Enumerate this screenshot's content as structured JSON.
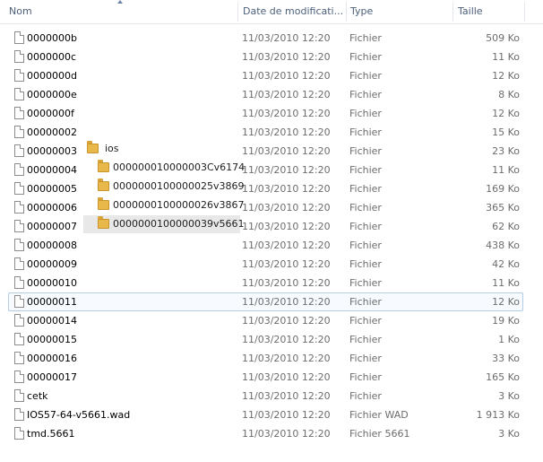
{
  "columns": {
    "name": "Nom",
    "date": "Date de modificati...",
    "type": "Type",
    "size": "Taille"
  },
  "files": [
    {
      "name": "0000000b",
      "date": "11/03/2010 12:20",
      "type": "Fichier",
      "size": "509 Ko"
    },
    {
      "name": "0000000c",
      "date": "11/03/2010 12:20",
      "type": "Fichier",
      "size": "11 Ko"
    },
    {
      "name": "0000000d",
      "date": "11/03/2010 12:20",
      "type": "Fichier",
      "size": "12 Ko"
    },
    {
      "name": "0000000e",
      "date": "11/03/2010 12:20",
      "type": "Fichier",
      "size": "8 Ko"
    },
    {
      "name": "0000000f",
      "date": "11/03/2010 12:20",
      "type": "Fichier",
      "size": "12 Ko"
    },
    {
      "name": "00000002",
      "date": "11/03/2010 12:20",
      "type": "Fichier",
      "size": "15 Ko"
    },
    {
      "name": "00000003",
      "date": "11/03/2010 12:20",
      "type": "Fichier",
      "size": "23 Ko"
    },
    {
      "name": "00000004",
      "date": "11/03/2010 12:20",
      "type": "Fichier",
      "size": "11 Ko"
    },
    {
      "name": "00000005",
      "date": "11/03/2010 12:20",
      "type": "Fichier",
      "size": "169 Ko"
    },
    {
      "name": "00000006",
      "date": "11/03/2010 12:20",
      "type": "Fichier",
      "size": "365 Ko"
    },
    {
      "name": "00000007",
      "date": "11/03/2010 12:20",
      "type": "Fichier",
      "size": "62 Ko"
    },
    {
      "name": "00000008",
      "date": "11/03/2010 12:20",
      "type": "Fichier",
      "size": "438 Ko"
    },
    {
      "name": "00000009",
      "date": "11/03/2010 12:20",
      "type": "Fichier",
      "size": "42 Ko"
    },
    {
      "name": "00000010",
      "date": "11/03/2010 12:20",
      "type": "Fichier",
      "size": "11 Ko"
    },
    {
      "name": "00000011",
      "date": "11/03/2010 12:20",
      "type": "Fichier",
      "size": "12 Ko"
    },
    {
      "name": "00000014",
      "date": "11/03/2010 12:20",
      "type": "Fichier",
      "size": "19 Ko"
    },
    {
      "name": "00000015",
      "date": "11/03/2010 12:20",
      "type": "Fichier",
      "size": "1 Ko"
    },
    {
      "name": "00000016",
      "date": "11/03/2010 12:20",
      "type": "Fichier",
      "size": "33 Ko"
    },
    {
      "name": "00000017",
      "date": "11/03/2010 12:20",
      "type": "Fichier",
      "size": "165 Ko"
    },
    {
      "name": "cetk",
      "date": "11/03/2010 12:20",
      "type": "Fichier",
      "size": "3 Ko"
    },
    {
      "name": "IOS57-64-v5661.wad",
      "date": "11/03/2010 12:20",
      "type": "Fichier WAD",
      "size": "1 913 Ko"
    },
    {
      "name": "tmd.5661",
      "date": "11/03/2010 12:20",
      "type": "Fichier 5661",
      "size": "3 Ko"
    }
  ],
  "selected_file": "00000011",
  "folder_tree": {
    "root": "ios",
    "children": [
      "000000010000003Cv6174",
      "0000000100000025v3869",
      "0000000100000026v3867",
      "0000000100000039v5661"
    ],
    "highlighted": "0000000100000039v5661"
  }
}
